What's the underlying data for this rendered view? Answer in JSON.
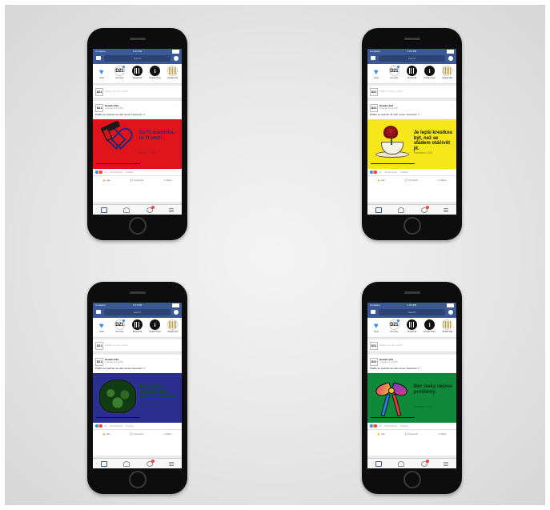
{
  "status": {
    "carrier": "Company",
    "time": "1:04 PM"
  },
  "search": {
    "placeholder": "Search"
  },
  "stories": [
    "Send",
    "Your story",
    "Divadlo 99",
    "Divadlo Husa",
    "Divadlo Diví"
  ],
  "composer": {
    "logo": "D21",
    "placeholder": "What's on your mind?"
  },
  "post": {
    "page_name": "Divadlo D21",
    "time": "Yesterday at 2:10 PM",
    "text": "Přijďte se podívat na naši novou inscenaci! ☺",
    "reaction_count": "91",
    "comments": "33 comments",
    "shares": "8 shares",
    "like": "Like",
    "comment": "Comment",
    "share": "Share"
  },
  "ads": [
    {
      "headline": "Co Ti maminka, to Ti oteč!",
      "sub": "Hamlet v D21",
      "bg": "#e0141a",
      "fg": "#1b2f7a",
      "art": "drill-heart"
    },
    {
      "headline": "Je lepší kreslkou být, než se stádem otáčivět jít.",
      "sub": "Premiéra v D21",
      "bg": "#f6e71a",
      "fg": "#111111",
      "art": "rose-cup"
    },
    {
      "headline": "Buď věrná hvězdě, tebe uvidí i v rozhlasu.",
      "sub": "Premiéra v D21",
      "bg": "#2b2f8f",
      "fg": "#0f5a12",
      "art": "pig"
    },
    {
      "headline": "Bez lásky nejsou problémy.",
      "sub": "Premiéra v D21",
      "bg": "#0f8a3a",
      "fg": "#0b2c10",
      "art": "bow"
    }
  ],
  "colors": {
    "facebook_blue": "#3b5998",
    "feed_bg": "#e9ebee"
  }
}
